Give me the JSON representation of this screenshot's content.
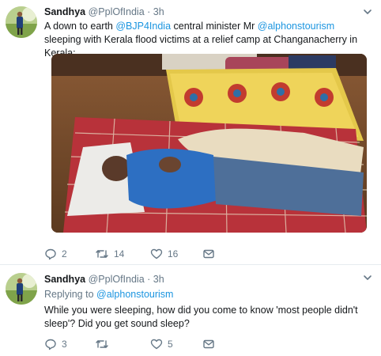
{
  "tweets": [
    {
      "author": {
        "name": "Sandhya",
        "handle": "@PplOfIndia",
        "separator": "·",
        "time": "3h"
      },
      "text": {
        "part1": "A down to earth ",
        "mention1": "@BJP4India",
        "part2": " central minister Mr ",
        "mention2": "@alphonstourism",
        "part3": " sleeping with Kerala flood victims at a relief camp at Changanacherry in Kerala:"
      },
      "actions": {
        "replies": "2",
        "retweets": "14",
        "likes": "16"
      }
    },
    {
      "author": {
        "name": "Sandhya",
        "handle": "@PplOfIndia",
        "separator": "·",
        "time": "3h"
      },
      "replying_to": {
        "prefix": "Replying to ",
        "handle": "@alphonstourism"
      },
      "text": {
        "body": "While you were sleeping, how did you come to know 'most people didn't sleep'? Did you get sound sleep?"
      },
      "actions": {
        "replies": "3",
        "retweets": "",
        "likes": "5"
      }
    }
  ],
  "colors": {
    "link": "#1b95e0",
    "muted": "#657786",
    "text": "#14171a",
    "divider": "#e6ecf0"
  },
  "icons": [
    "avatar-photo",
    "chevron-down-icon",
    "reply-icon",
    "retweet-icon",
    "like-icon",
    "direct-message-icon"
  ]
}
